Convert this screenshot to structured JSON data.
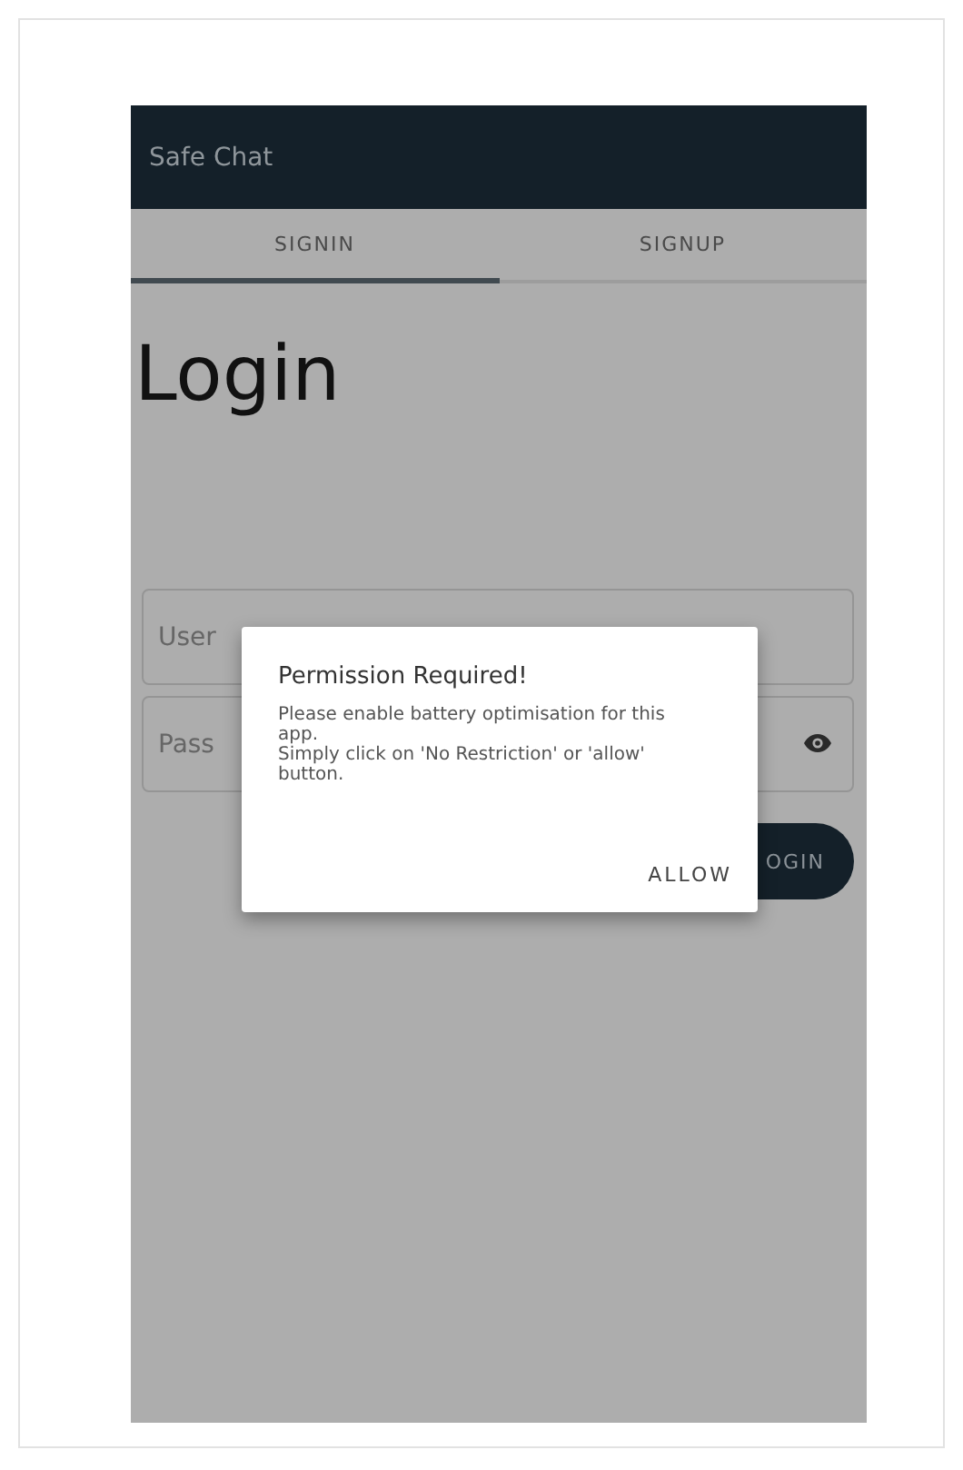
{
  "app_bar": {
    "title": "Safe Chat"
  },
  "tabs": [
    {
      "label": "SIGNIN",
      "selected": true
    },
    {
      "label": "SIGNUP",
      "selected": false
    }
  ],
  "heading": "Login",
  "fields": [
    {
      "placeholder": "User",
      "kind": "text"
    },
    {
      "placeholder": "Pass",
      "kind": "password"
    }
  ],
  "login_button": "OGIN",
  "dialog": {
    "title": "Permission Required!",
    "message": [
      "Please enable battery optimisation for this app.",
      "Simply click on 'No Restriction' or 'allow' button."
    ],
    "action": "ALLOW"
  }
}
